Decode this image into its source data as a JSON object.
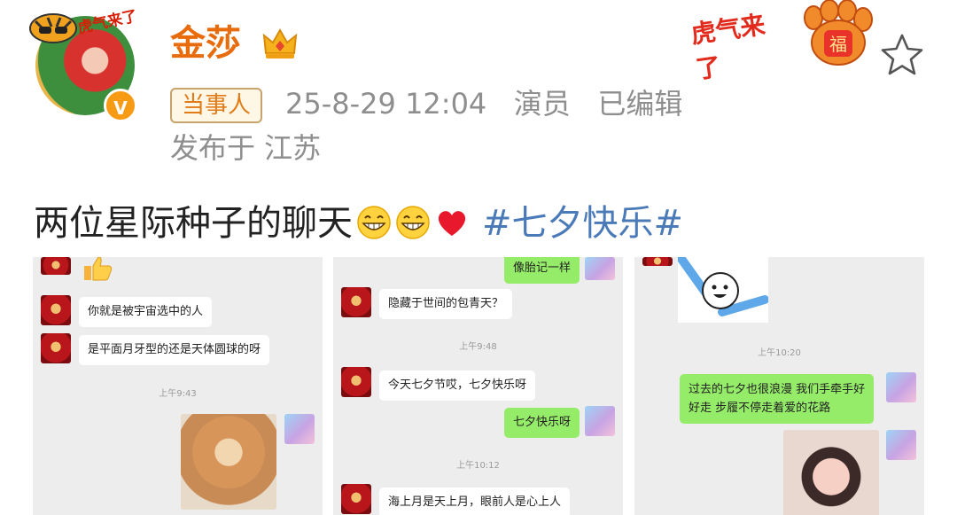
{
  "header": {
    "username": "金莎",
    "avatar_tag": "虎气来了",
    "role_badge": "当事人",
    "meta": "25-8-29 12:04   演员   已编辑",
    "location": "发布于 江苏"
  },
  "decor": {
    "sticker_text": "虎气来了"
  },
  "post": {
    "text": "两位星际种子的聊天",
    "hashtag": "#七夕快乐#"
  },
  "screenshots": [
    {
      "messages": [
        {
          "text": "你就是被宇宙选中的人"
        },
        {
          "text": "是平面月牙型的还是天体圆球的呀"
        }
      ],
      "time": "上午9:43"
    },
    {
      "messages": [
        {
          "text": "像胎记一样"
        },
        {
          "text": "隐藏于世间的包青天？"
        },
        {
          "text": "今天七夕节哎，七夕快乐呀"
        },
        {
          "text": "七夕快乐呀"
        },
        {
          "text": "海上月是天上月，眼前人是心上人"
        }
      ],
      "times": [
        "上午9:48",
        "上午10:12"
      ]
    },
    {
      "messages": [
        {
          "text": "过去的七夕也很浪漫 我们手牵手好\n好走 步履不停走着爱的花路"
        }
      ],
      "time": "上午10:20"
    }
  ],
  "colors": {
    "username": "#e86b0c",
    "hashtag": "#4b7ab8",
    "meta": "#8e8e8e",
    "green_bubble": "#95ec69"
  },
  "icons": [
    "crown-icon",
    "verified-icon",
    "paw-icon",
    "star-icon",
    "grin-emoji",
    "heart-emoji",
    "thumbs-up-emoji"
  ]
}
